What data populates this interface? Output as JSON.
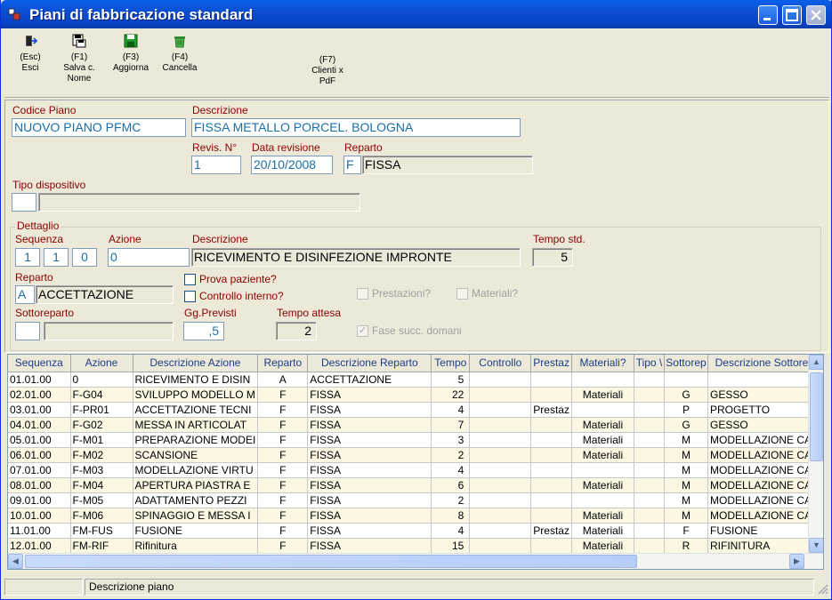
{
  "window": {
    "title": "Piani di fabbricazione standard"
  },
  "toolbar": {
    "esc": {
      "key": "(Esc)",
      "label": "Esci"
    },
    "f1": {
      "key": "(F1)",
      "label1": "Salva c.",
      "label2": "Nome"
    },
    "f3": {
      "key": "(F3)",
      "label": "Aggiorna"
    },
    "f4": {
      "key": "(F4)",
      "label": "Cancella"
    },
    "f7": {
      "key": "(F7)",
      "label1": "Clienti x",
      "label2": "PdF"
    }
  },
  "header": {
    "codice_label": "Codice Piano",
    "codice_value": "NUOVO PIANO PFMC",
    "descr_label": "Descrizione",
    "descr_value": "FISSA  METALLO PORCEL. BOLOGNA",
    "revis_label": "Revis. N°",
    "revis_value": "1",
    "data_label": "Data revisione",
    "data_value": "20/10/2008",
    "reparto_label": "Reparto",
    "reparto_code": "F",
    "reparto_desc": "FISSA",
    "tipo_label": "Tipo dispositivo",
    "tipo_code": "",
    "tipo_desc": ""
  },
  "detail": {
    "group_title": "Dettaglio",
    "seq_label": "Sequenza",
    "seq1": "1",
    "seq2": "1",
    "seq3": "0",
    "azione_label": "Azione",
    "azione_value": "0",
    "descr_label": "Descrizione",
    "descr_value": "RICEVIMENTO E DISINFEZIONE IMPRONTE",
    "tempo_label": "Tempo std.",
    "tempo_value": "5",
    "reparto_label": "Reparto",
    "reparto_code": "A",
    "reparto_desc": "ACCETTAZIONE",
    "prova_label": "Prova paziente?",
    "prova_checked": false,
    "controllo_label": "Controllo interno?",
    "controllo_checked": false,
    "prestazioni_label": "Prestazioni?",
    "materiali_label": "Materiali?",
    "sottorep_label": "Sottoreparto",
    "sottorep_code": "",
    "sottorep_desc": "",
    "gg_label": "Gg.Previsti",
    "gg_value": ",5",
    "attesa_label": "Tempo attesa",
    "attesa_value": "2",
    "fase_label": "Fase succ. domani",
    "fase_checked": true
  },
  "grid": {
    "columns": [
      "Sequenza",
      "Azione",
      "Descrizione Azione",
      "Reparto",
      "Descrizione Reparto",
      "Tempo",
      "Controllo",
      "Prestaz",
      "Materiali?",
      "Tipo \\",
      "Sottorep",
      "Descrizione Sottorep"
    ],
    "rows": [
      [
        "01.01.00",
        "0",
        "RICEVIMENTO E DISIN",
        "A",
        "ACCETTAZIONE",
        "5",
        "",
        "",
        "",
        "",
        "",
        ""
      ],
      [
        "02.01.00",
        "F-G04",
        "SVILUPPO MODELLO M",
        "F",
        "FISSA",
        "22",
        "",
        "",
        "Materiali",
        "",
        "G",
        "GESSO"
      ],
      [
        "03.01.00",
        "F-PR01",
        "ACCETTAZIONE TECNI",
        "F",
        "FISSA",
        "4",
        "",
        "Prestaz",
        "",
        "",
        "P",
        "PROGETTO"
      ],
      [
        "04.01.00",
        "F-G02",
        "MESSA IN ARTICOLAT",
        "F",
        "FISSA",
        "7",
        "",
        "",
        "Materiali",
        "",
        "G",
        "GESSO"
      ],
      [
        "05.01.00",
        "F-M01",
        "PREPARAZIONE MODEI",
        "F",
        "FISSA",
        "3",
        "",
        "",
        "Materiali",
        "",
        "M",
        "MODELLAZIONE CAD"
      ],
      [
        "06.01.00",
        "F-M02",
        "SCANSIONE",
        "F",
        "FISSA",
        "2",
        "",
        "",
        "Materiali",
        "",
        "M",
        "MODELLAZIONE CAD"
      ],
      [
        "07.01.00",
        "F-M03",
        "MODELLAZIONE VIRTU",
        "F",
        "FISSA",
        "4",
        "",
        "",
        "",
        "",
        "M",
        "MODELLAZIONE CAD"
      ],
      [
        "08.01.00",
        "F-M04",
        "APERTURA PIASTRA E",
        "F",
        "FISSA",
        "6",
        "",
        "",
        "Materiali",
        "",
        "M",
        "MODELLAZIONE CAD"
      ],
      [
        "09.01.00",
        "F-M05",
        "ADATTAMENTO PEZZI",
        "F",
        "FISSA",
        "2",
        "",
        "",
        "",
        "",
        "M",
        "MODELLAZIONE CAD"
      ],
      [
        "10.01.00",
        "F-M06",
        "SPINAGGIO E MESSA I",
        "F",
        "FISSA",
        "8",
        "",
        "",
        "Materiali",
        "",
        "M",
        "MODELLAZIONE CAD"
      ],
      [
        "11.01.00",
        "FM-FUS",
        "FUSIONE",
        "F",
        "FISSA",
        "4",
        "",
        "Prestaz",
        "Materiali",
        "",
        "F",
        "FUSIONE"
      ],
      [
        "12.01.00",
        "FM-RIF",
        "Rifinitura",
        "F",
        "FISSA",
        "15",
        "",
        "",
        "Materiali",
        "",
        "R",
        "RIFINITURA"
      ]
    ]
  },
  "status": {
    "panel1": "",
    "panel2": "Descrizione piano"
  },
  "colors": {
    "title_bar": "#0b4fd2",
    "label_red": "#8b0000",
    "value_blue": "#1a6fa8",
    "header_blue": "#1c3c8c"
  }
}
